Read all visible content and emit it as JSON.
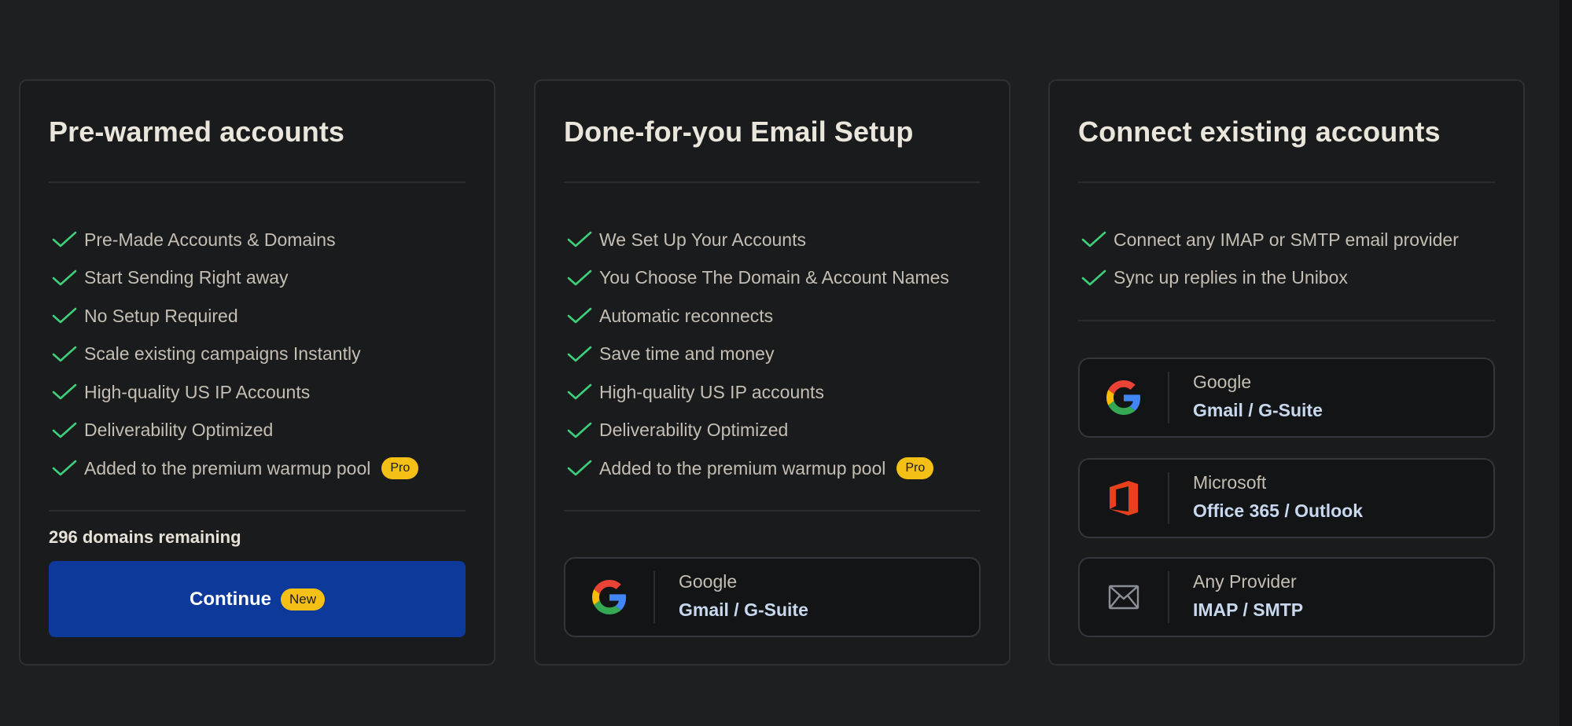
{
  "cards": [
    {
      "title": "Pre-warmed accounts",
      "features": [
        "Pre-Made Accounts & Domains",
        "Start Sending Right away",
        "No Setup Required",
        "Scale existing campaigns Instantly",
        "High-quality US IP Accounts",
        "Deliverability Optimized",
        "Added to the premium warmup pool"
      ],
      "feature_badge": "Pro",
      "remaining": "296 domains remaining",
      "continue_label": "Continue",
      "continue_badge": "New"
    },
    {
      "title": "Done-for-you Email Setup",
      "features": [
        "We Set Up Your Accounts",
        "You Choose The Domain & Account Names",
        "Automatic reconnects",
        "Save time and money",
        "High-quality US IP accounts",
        "Deliverability Optimized",
        "Added to the premium warmup pool"
      ],
      "feature_badge": "Pro",
      "providers": [
        {
          "name": "Google",
          "sub": "Gmail / G-Suite",
          "icon": "google-icon"
        }
      ]
    },
    {
      "title": "Connect existing accounts",
      "features": [
        "Connect any IMAP or SMTP email provider",
        "Sync up replies in the Unibox"
      ],
      "providers": [
        {
          "name": "Google",
          "sub": "Gmail / G-Suite",
          "icon": "google-icon"
        },
        {
          "name": "Microsoft",
          "sub": "Office 365 / Outlook",
          "icon": "office-icon"
        },
        {
          "name": "Any Provider",
          "sub": "IMAP / SMTP",
          "icon": "mail-icon"
        }
      ]
    }
  ],
  "colors": {
    "background": "#1e1f21",
    "card": "#1a1b1d",
    "check": "#3ecf7a",
    "badge": "#f5c016",
    "primary_button": "#0d3a9a"
  }
}
